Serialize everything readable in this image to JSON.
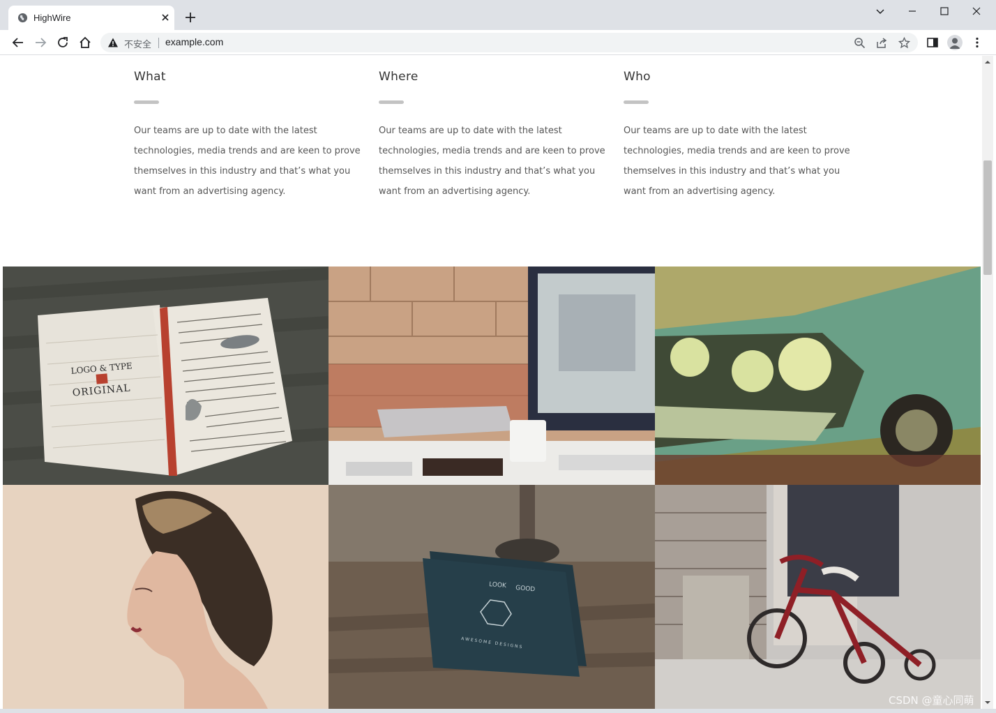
{
  "browser": {
    "tab_title": "HighWire",
    "security_label": "不安全",
    "url": "example.com"
  },
  "features": [
    {
      "title": "What",
      "text": "Our teams are up to date with the latest technologies, media trends and are keen to prove themselves in this industry and that’s what you want from an advertising agency."
    },
    {
      "title": "Where",
      "text": "Our teams are up to date with the latest technologies, media trends and are keen to prove themselves in this industry and that’s what you want from an advertising agency."
    },
    {
      "title": "Who",
      "text": "Our teams are up to date with the latest technologies, media trends and are keen to prove themselves in this industry and that’s what you want from an advertising agency."
    }
  ],
  "gallery": {
    "notebook": {
      "line1": "LOGO & TYPE",
      "line2": "ORIGINAL"
    },
    "business_card": {
      "line1": "LOOK",
      "line2": "GOOD",
      "line3": "AWESOME DESIGNS"
    }
  },
  "watermark": "CSDN @童心同萌"
}
